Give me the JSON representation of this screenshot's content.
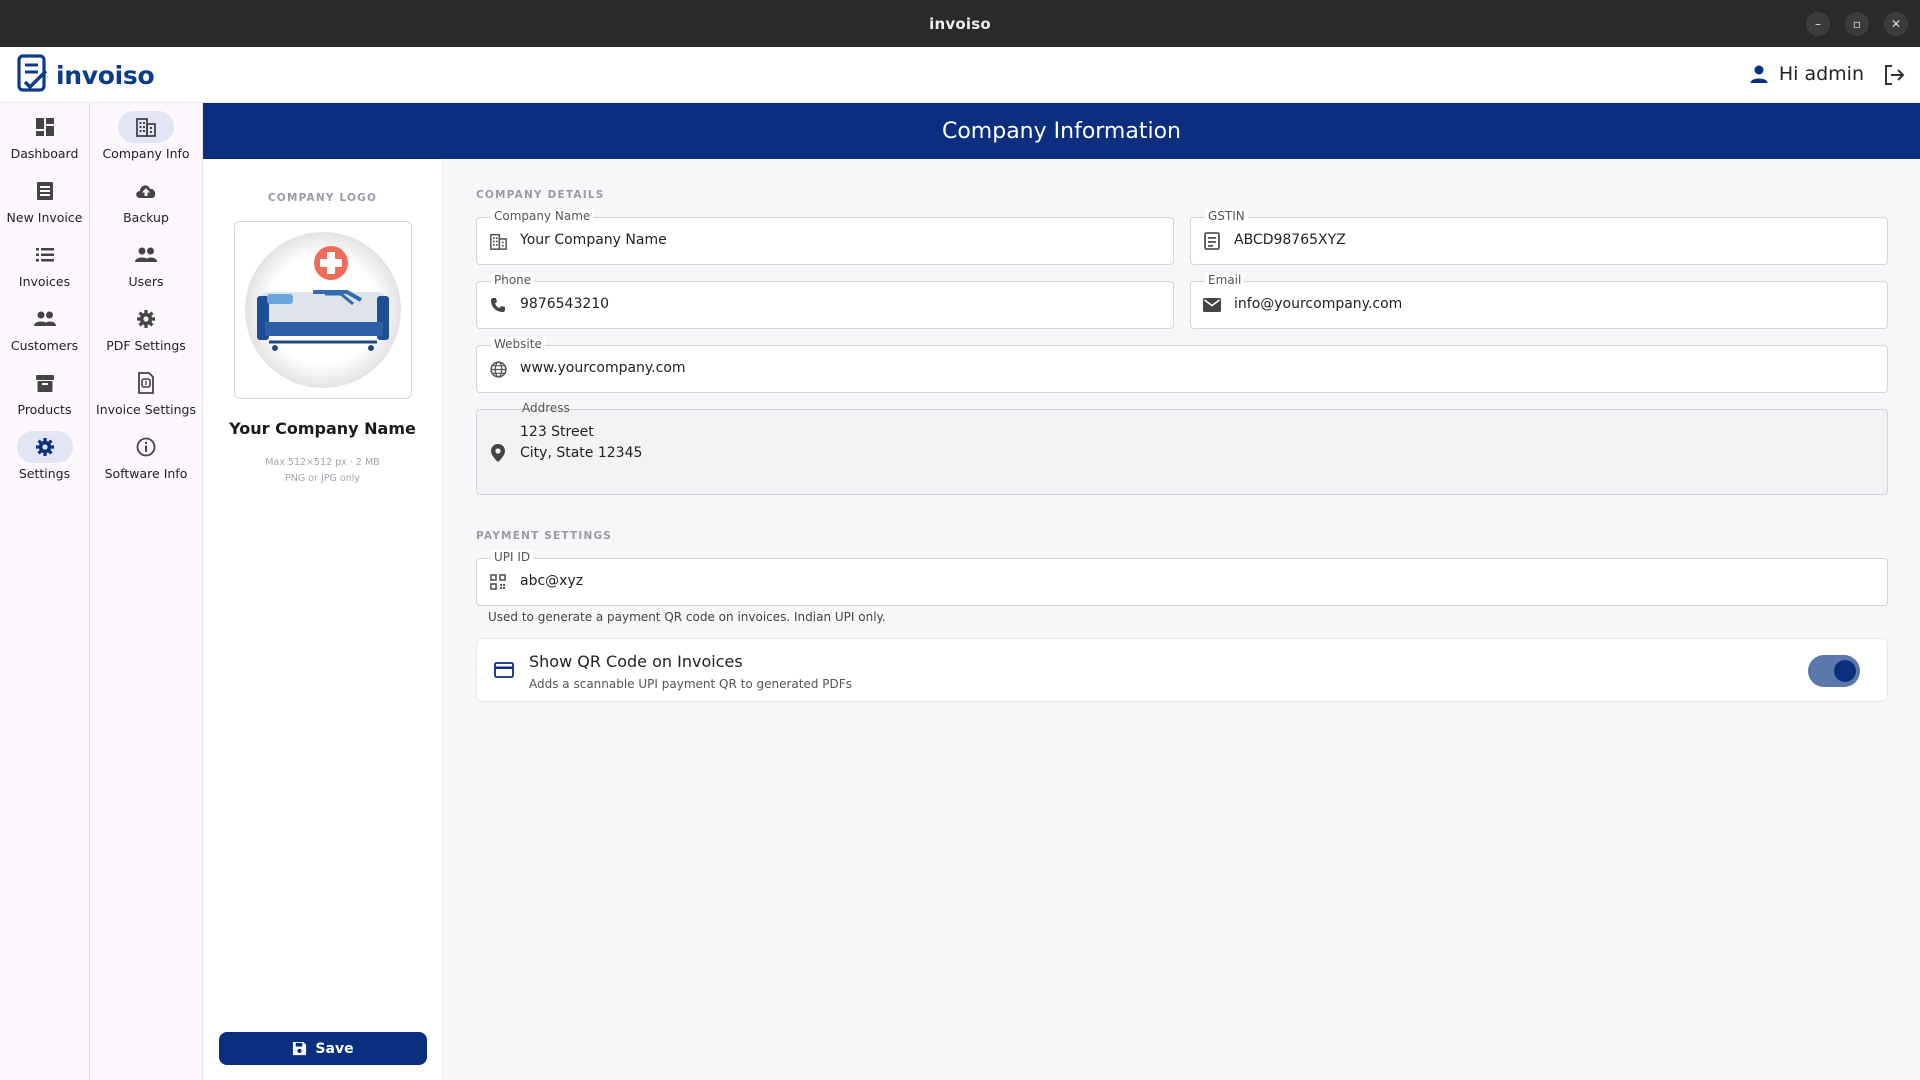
{
  "window": {
    "title": "invoiso",
    "minimize": "–",
    "maximize": "▫",
    "close": "✕"
  },
  "app": {
    "brand": "invoiso",
    "greeting": "Hi admin"
  },
  "rail_primary": [
    {
      "label": "Dashboard",
      "icon": "dashboard-icon"
    },
    {
      "label": "New Invoice",
      "icon": "receipt-icon"
    },
    {
      "label": "Invoices",
      "icon": "list-icon"
    },
    {
      "label": "Customers",
      "icon": "people-icon"
    },
    {
      "label": "Products",
      "icon": "archive-icon"
    },
    {
      "label": "Settings",
      "icon": "gear-icon",
      "active": true
    }
  ],
  "rail_secondary": [
    {
      "label": "Company Info",
      "icon": "building-icon",
      "active": true
    },
    {
      "label": "Backup",
      "icon": "cloud-upload-icon"
    },
    {
      "label": "Users",
      "icon": "people-icon"
    },
    {
      "label": "PDF Settings",
      "icon": "gear-icon"
    },
    {
      "label": "Invoice Settings",
      "icon": "document-icon"
    },
    {
      "label": "Software Info",
      "icon": "info-icon"
    }
  ],
  "page": {
    "title": "Company Information"
  },
  "logo_panel": {
    "section_label": "COMPANY LOGO",
    "company_name": "Your Company Name",
    "hint_1": "Max 512×512 px · 2 MB",
    "hint_2": "PNG or JPG only",
    "save_label": "Save"
  },
  "company_details": {
    "section_label": "COMPANY DETAILS",
    "company_name": {
      "label": "Company Name",
      "value": "Your Company Name"
    },
    "gstin": {
      "label": "GSTIN",
      "value": "ABCD98765XYZ"
    },
    "phone": {
      "label": "Phone",
      "value": "9876543210"
    },
    "email": {
      "label": "Email",
      "value": "info@yourcompany.com"
    },
    "website": {
      "label": "Website",
      "value": "www.yourcompany.com"
    },
    "address": {
      "label": "Address",
      "line1": "123 Street",
      "line2": "City, State 12345"
    }
  },
  "payment_settings": {
    "section_label": "PAYMENT SETTINGS",
    "upi": {
      "label": "UPI ID",
      "value": "abc@xyz"
    },
    "upi_helper": "Used to generate a payment QR code on invoices. Indian UPI only.",
    "qr_toggle": {
      "title": "Show QR Code on Invoices",
      "subtitle": "Adds a scannable UPI payment QR to generated PDFs",
      "enabled": true
    }
  },
  "colors": {
    "primary": "#0b2f7e",
    "toggle_track": "#5b78aa",
    "rail_bg": "#fdf7fe",
    "active_pill": "#e2e5f5"
  }
}
